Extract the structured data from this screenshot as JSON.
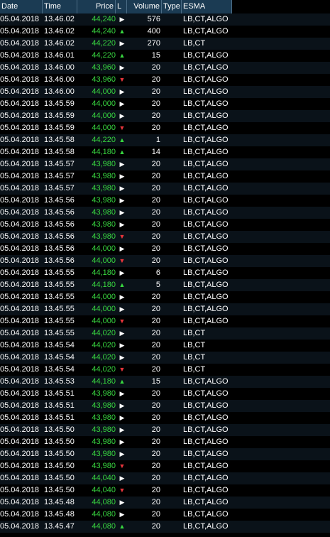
{
  "headers": {
    "date": "Date",
    "time": "Time",
    "price": "Price",
    "l": "L",
    "volume": "Volume",
    "type": "Type",
    "esma": "ESMA"
  },
  "rows": [
    {
      "date": "05.04.2018",
      "time": "13.46.02",
      "price": "44,240",
      "price_color": "green",
      "dir": "right",
      "volume": "576",
      "type": "",
      "esma": "LB,CT,ALGO"
    },
    {
      "date": "05.04.2018",
      "time": "13.46.02",
      "price": "44,240",
      "price_color": "green",
      "dir": "up",
      "volume": "400",
      "type": "",
      "esma": "LB,CT,ALGO"
    },
    {
      "date": "05.04.2018",
      "time": "13.46.02",
      "price": "44,220",
      "price_color": "green",
      "dir": "right",
      "volume": "270",
      "type": "",
      "esma": "LB,CT"
    },
    {
      "date": "05.04.2018",
      "time": "13.46.01",
      "price": "44,220",
      "price_color": "green",
      "dir": "up",
      "volume": "15",
      "type": "",
      "esma": "LB,CT,ALGO"
    },
    {
      "date": "05.04.2018",
      "time": "13.46.00",
      "price": "43,960",
      "price_color": "green",
      "dir": "right",
      "volume": "20",
      "type": "",
      "esma": "LB,CT,ALGO"
    },
    {
      "date": "05.04.2018",
      "time": "13.46.00",
      "price": "43,960",
      "price_color": "green",
      "dir": "down",
      "volume": "20",
      "type": "",
      "esma": "LB,CT,ALGO"
    },
    {
      "date": "05.04.2018",
      "time": "13.46.00",
      "price": "44,000",
      "price_color": "green",
      "dir": "right",
      "volume": "20",
      "type": "",
      "esma": "LB,CT,ALGO"
    },
    {
      "date": "05.04.2018",
      "time": "13.45.59",
      "price": "44,000",
      "price_color": "green",
      "dir": "right",
      "volume": "20",
      "type": "",
      "esma": "LB,CT,ALGO"
    },
    {
      "date": "05.04.2018",
      "time": "13.45.59",
      "price": "44,000",
      "price_color": "green",
      "dir": "right",
      "volume": "20",
      "type": "",
      "esma": "LB,CT,ALGO"
    },
    {
      "date": "05.04.2018",
      "time": "13.45.59",
      "price": "44,000",
      "price_color": "green",
      "dir": "down",
      "volume": "20",
      "type": "",
      "esma": "LB,CT,ALGO"
    },
    {
      "date": "05.04.2018",
      "time": "13.45.58",
      "price": "44,220",
      "price_color": "green",
      "dir": "up",
      "volume": "1",
      "type": "",
      "esma": "LB,CT,ALGO"
    },
    {
      "date": "05.04.2018",
      "time": "13.45.58",
      "price": "44,180",
      "price_color": "green",
      "dir": "up",
      "volume": "14",
      "type": "",
      "esma": "LB,CT,ALGO"
    },
    {
      "date": "05.04.2018",
      "time": "13.45.57",
      "price": "43,980",
      "price_color": "green",
      "dir": "right",
      "volume": "20",
      "type": "",
      "esma": "LB,CT,ALGO"
    },
    {
      "date": "05.04.2018",
      "time": "13.45.57",
      "price": "43,980",
      "price_color": "green",
      "dir": "right",
      "volume": "20",
      "type": "",
      "esma": "LB,CT,ALGO"
    },
    {
      "date": "05.04.2018",
      "time": "13.45.57",
      "price": "43,980",
      "price_color": "green",
      "dir": "right",
      "volume": "20",
      "type": "",
      "esma": "LB,CT,ALGO"
    },
    {
      "date": "05.04.2018",
      "time": "13.45.56",
      "price": "43,980",
      "price_color": "green",
      "dir": "right",
      "volume": "20",
      "type": "",
      "esma": "LB,CT,ALGO"
    },
    {
      "date": "05.04.2018",
      "time": "13.45.56",
      "price": "43,980",
      "price_color": "green",
      "dir": "right",
      "volume": "20",
      "type": "",
      "esma": "LB,CT,ALGO"
    },
    {
      "date": "05.04.2018",
      "time": "13.45.56",
      "price": "43,980",
      "price_color": "green",
      "dir": "right",
      "volume": "20",
      "type": "",
      "esma": "LB,CT,ALGO"
    },
    {
      "date": "05.04.2018",
      "time": "13.45.56",
      "price": "43,980",
      "price_color": "green",
      "dir": "down",
      "volume": "20",
      "type": "",
      "esma": "LB,CT,ALGO"
    },
    {
      "date": "05.04.2018",
      "time": "13.45.56",
      "price": "44,000",
      "price_color": "green",
      "dir": "right",
      "volume": "20",
      "type": "",
      "esma": "LB,CT,ALGO"
    },
    {
      "date": "05.04.2018",
      "time": "13.45.56",
      "price": "44,000",
      "price_color": "green",
      "dir": "down",
      "volume": "20",
      "type": "",
      "esma": "LB,CT,ALGO"
    },
    {
      "date": "05.04.2018",
      "time": "13.45.55",
      "price": "44,180",
      "price_color": "green",
      "dir": "right",
      "volume": "6",
      "type": "",
      "esma": "LB,CT,ALGO"
    },
    {
      "date": "05.04.2018",
      "time": "13.45.55",
      "price": "44,180",
      "price_color": "green",
      "dir": "up",
      "volume": "5",
      "type": "",
      "esma": "LB,CT,ALGO"
    },
    {
      "date": "05.04.2018",
      "time": "13.45.55",
      "price": "44,000",
      "price_color": "green",
      "dir": "right",
      "volume": "20",
      "type": "",
      "esma": "LB,CT,ALGO"
    },
    {
      "date": "05.04.2018",
      "time": "13.45.55",
      "price": "44,000",
      "price_color": "green",
      "dir": "right",
      "volume": "20",
      "type": "",
      "esma": "LB,CT,ALGO"
    },
    {
      "date": "05.04.2018",
      "time": "13.45.55",
      "price": "44,000",
      "price_color": "green",
      "dir": "down",
      "volume": "20",
      "type": "",
      "esma": "LB,CT,ALGO"
    },
    {
      "date": "05.04.2018",
      "time": "13.45.55",
      "price": "44,020",
      "price_color": "green",
      "dir": "right",
      "volume": "20",
      "type": "",
      "esma": "LB,CT"
    },
    {
      "date": "05.04.2018",
      "time": "13.45.54",
      "price": "44,020",
      "price_color": "green",
      "dir": "right",
      "volume": "20",
      "type": "",
      "esma": "LB,CT"
    },
    {
      "date": "05.04.2018",
      "time": "13.45.54",
      "price": "44,020",
      "price_color": "green",
      "dir": "right",
      "volume": "20",
      "type": "",
      "esma": "LB,CT"
    },
    {
      "date": "05.04.2018",
      "time": "13.45.54",
      "price": "44,020",
      "price_color": "green",
      "dir": "down",
      "volume": "20",
      "type": "",
      "esma": "LB,CT"
    },
    {
      "date": "05.04.2018",
      "time": "13.45.53",
      "price": "44,180",
      "price_color": "green",
      "dir": "up",
      "volume": "15",
      "type": "",
      "esma": "LB,CT,ALGO"
    },
    {
      "date": "05.04.2018",
      "time": "13.45.51",
      "price": "43,980",
      "price_color": "green",
      "dir": "right",
      "volume": "20",
      "type": "",
      "esma": "LB,CT,ALGO"
    },
    {
      "date": "05.04.2018",
      "time": "13.45.51",
      "price": "43,980",
      "price_color": "green",
      "dir": "right",
      "volume": "20",
      "type": "",
      "esma": "LB,CT,ALGO"
    },
    {
      "date": "05.04.2018",
      "time": "13.45.51",
      "price": "43,980",
      "price_color": "green",
      "dir": "right",
      "volume": "20",
      "type": "",
      "esma": "LB,CT,ALGO"
    },
    {
      "date": "05.04.2018",
      "time": "13.45.50",
      "price": "43,980",
      "price_color": "green",
      "dir": "right",
      "volume": "20",
      "type": "",
      "esma": "LB,CT,ALGO"
    },
    {
      "date": "05.04.2018",
      "time": "13.45.50",
      "price": "43,980",
      "price_color": "green",
      "dir": "right",
      "volume": "20",
      "type": "",
      "esma": "LB,CT,ALGO"
    },
    {
      "date": "05.04.2018",
      "time": "13.45.50",
      "price": "43,980",
      "price_color": "green",
      "dir": "right",
      "volume": "20",
      "type": "",
      "esma": "LB,CT,ALGO"
    },
    {
      "date": "05.04.2018",
      "time": "13.45.50",
      "price": "43,980",
      "price_color": "green",
      "dir": "down",
      "volume": "20",
      "type": "",
      "esma": "LB,CT,ALGO"
    },
    {
      "date": "05.04.2018",
      "time": "13.45.50",
      "price": "44,040",
      "price_color": "green",
      "dir": "right",
      "volume": "20",
      "type": "",
      "esma": "LB,CT,ALGO"
    },
    {
      "date": "05.04.2018",
      "time": "13.45.50",
      "price": "44,040",
      "price_color": "green",
      "dir": "down",
      "volume": "20",
      "type": "",
      "esma": "LB,CT,ALGO"
    },
    {
      "date": "05.04.2018",
      "time": "13.45.48",
      "price": "44,080",
      "price_color": "green",
      "dir": "right",
      "volume": "20",
      "type": "",
      "esma": "LB,CT,ALGO"
    },
    {
      "date": "05.04.2018",
      "time": "13.45.48",
      "price": "44,080",
      "price_color": "green",
      "dir": "right",
      "volume": "20",
      "type": "",
      "esma": "LB,CT,ALGO"
    },
    {
      "date": "05.04.2018",
      "time": "13.45.47",
      "price": "44,080",
      "price_color": "green",
      "dir": "up",
      "volume": "20",
      "type": "",
      "esma": "LB,CT,ALGO"
    }
  ],
  "colors": {
    "header_bg": "#1b3b53",
    "price_green": "#38d640",
    "arrow_up": "#38d640",
    "arrow_down": "#e8353c",
    "arrow_flat": "#ffffff"
  }
}
